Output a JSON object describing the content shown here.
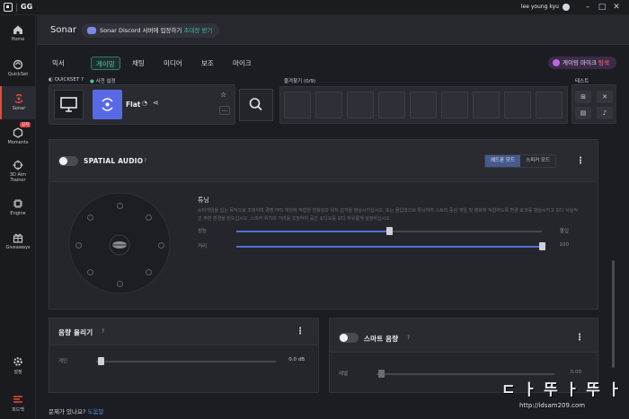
{
  "titlebar": {
    "brand": "GG",
    "user": "lee young kyu",
    "minimize": "–",
    "maximize": "□",
    "close": "✕"
  },
  "sidebar": {
    "items": [
      {
        "label": "Home",
        "icon": "home-icon"
      },
      {
        "label": "QuickSet",
        "icon": "quickset-icon"
      },
      {
        "label": "Sonar",
        "icon": "sonar-icon",
        "active": true
      },
      {
        "label": "Moments",
        "icon": "moments-icon",
        "badge": "공지"
      },
      {
        "label": "3D Aim Trainer",
        "icon": "crosshair-icon"
      },
      {
        "label": "Engine",
        "icon": "chip-icon"
      },
      {
        "label": "Giveaways",
        "icon": "gift-icon"
      }
    ],
    "bottom": [
      {
        "label": "설정",
        "icon": "gear-icon"
      },
      {
        "label": "피드백",
        "icon": "feedback-icon"
      }
    ]
  },
  "header": {
    "title": "Sonar",
    "discord_text": "Sonar Discord 서버에 입장하기",
    "discord_link": "초대장 받기"
  },
  "tabs": {
    "items": [
      "믹서",
      "게이밍",
      "채팅",
      "미디어",
      "보조",
      "마이크"
    ],
    "active": "게이밍",
    "gaming_mic_label": "게이밍 마이크",
    "gaming_mic_action": "탐색"
  },
  "quickset": {
    "label": "QUICKSET",
    "help": "?",
    "preset_label": "사전 설정",
    "preset_name": "Flat",
    "favorites_label": "즐겨찾기 (0/9)",
    "favorite_slots": 9,
    "test_label": "테스트"
  },
  "spatial": {
    "title": "SPATIAL AUDIO",
    "help": "?",
    "modes": [
      "헤드폰 모드",
      "스피커 모드"
    ],
    "active_mode": "헤드폰 모드",
    "tuning_title": "튜닝",
    "tuning_desc": "슈터게임을 쉽는 목적으로 조정하며 경쟁 FPS 게임에 적합한 방향성과 위치 감각을 향상시키십시오. 또는 몰입형으로 튜닝하여 스토리 중심 게임 및 영화에 적합하도록 환경 효과를 향상시키고 보다 사실적인 주변 환경을 만드십시오. 스피커 위치와 거리를 조정하여 공간 오디오를 보다 자유롭게 설정하십시오.",
    "sliders": [
      {
        "label": "성능",
        "right_label": "몰입",
        "value_pct": 50
      },
      {
        "label": "거리",
        "right_label": "100",
        "value_pct": 100
      }
    ]
  },
  "volume_boost": {
    "title": "음량 올리기",
    "help": "?",
    "gain_label": "게인",
    "gain_value": "0.0 dB"
  },
  "smart_volume": {
    "title": "스마트 음량",
    "help": "?",
    "level_label": "레벨",
    "level_value": "0.00"
  },
  "footer": {
    "question": "문제가 있나요?",
    "link": "도움말"
  },
  "watermark": {
    "title": "ㄷ ㅏ 뚜 ㅏ 뚜 ㅏ",
    "url": "http://idsam209.com"
  }
}
